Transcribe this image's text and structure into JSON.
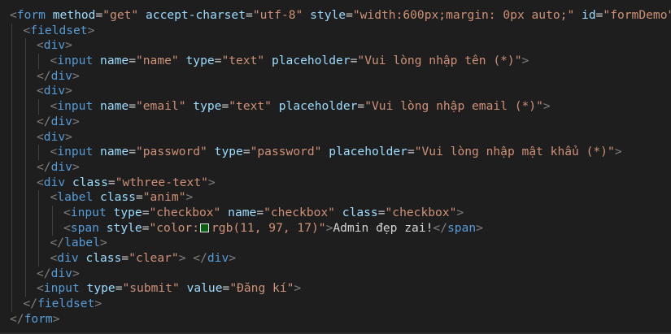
{
  "editor": {
    "language": "html",
    "theme": "dark",
    "lines": [
      {
        "indent": 0,
        "tokens": [
          {
            "t": "punc",
            "v": "<"
          },
          {
            "t": "tag",
            "v": "form"
          },
          {
            "t": "text",
            "v": " "
          },
          {
            "t": "attr",
            "v": "method"
          },
          {
            "t": "text",
            "v": "="
          },
          {
            "t": "str",
            "v": "\"get\""
          },
          {
            "t": "text",
            "v": " "
          },
          {
            "t": "attr",
            "v": "accept-charset"
          },
          {
            "t": "text",
            "v": "="
          },
          {
            "t": "str",
            "v": "\"utf-8\""
          },
          {
            "t": "text",
            "v": " "
          },
          {
            "t": "attr",
            "v": "style"
          },
          {
            "t": "text",
            "v": "="
          },
          {
            "t": "str",
            "v": "\"width:600px;margin: 0px auto;\""
          },
          {
            "t": "text",
            "v": " "
          },
          {
            "t": "attr",
            "v": "id"
          },
          {
            "t": "text",
            "v": "="
          },
          {
            "t": "str",
            "v": "\"formDemo\""
          },
          {
            "t": "punc",
            "v": ">"
          }
        ]
      },
      {
        "indent": 1,
        "tokens": [
          {
            "t": "punc",
            "v": "<"
          },
          {
            "t": "tag",
            "v": "fieldset"
          },
          {
            "t": "punc",
            "v": ">"
          }
        ]
      },
      {
        "indent": 2,
        "tokens": [
          {
            "t": "punc",
            "v": "<"
          },
          {
            "t": "tag",
            "v": "div"
          },
          {
            "t": "punc",
            "v": ">"
          }
        ]
      },
      {
        "indent": 3,
        "tokens": [
          {
            "t": "punc",
            "v": "<"
          },
          {
            "t": "tag",
            "v": "input"
          },
          {
            "t": "text",
            "v": " "
          },
          {
            "t": "attr",
            "v": "name"
          },
          {
            "t": "text",
            "v": "="
          },
          {
            "t": "str",
            "v": "\"name\""
          },
          {
            "t": "text",
            "v": " "
          },
          {
            "t": "attr",
            "v": "type"
          },
          {
            "t": "text",
            "v": "="
          },
          {
            "t": "str",
            "v": "\"text\""
          },
          {
            "t": "text",
            "v": " "
          },
          {
            "t": "attr",
            "v": "placeholder"
          },
          {
            "t": "text",
            "v": "="
          },
          {
            "t": "str",
            "v": "\"Vui lòng nhập tên (*)\""
          },
          {
            "t": "punc",
            "v": ">"
          }
        ]
      },
      {
        "indent": 2,
        "tokens": [
          {
            "t": "punc",
            "v": "</"
          },
          {
            "t": "tag",
            "v": "div"
          },
          {
            "t": "punc",
            "v": ">"
          }
        ]
      },
      {
        "indent": 2,
        "tokens": [
          {
            "t": "punc",
            "v": "<"
          },
          {
            "t": "tag",
            "v": "div"
          },
          {
            "t": "punc",
            "v": ">"
          }
        ]
      },
      {
        "indent": 3,
        "tokens": [
          {
            "t": "punc",
            "v": "<"
          },
          {
            "t": "tag",
            "v": "input"
          },
          {
            "t": "text",
            "v": " "
          },
          {
            "t": "attr",
            "v": "name"
          },
          {
            "t": "text",
            "v": "="
          },
          {
            "t": "str",
            "v": "\"email\""
          },
          {
            "t": "text",
            "v": " "
          },
          {
            "t": "attr",
            "v": "type"
          },
          {
            "t": "text",
            "v": "="
          },
          {
            "t": "str",
            "v": "\"text\""
          },
          {
            "t": "text",
            "v": " "
          },
          {
            "t": "attr",
            "v": "placeholder"
          },
          {
            "t": "text",
            "v": "="
          },
          {
            "t": "str",
            "v": "\"Vui lòng nhập email (*)\""
          },
          {
            "t": "punc",
            "v": ">"
          }
        ]
      },
      {
        "indent": 2,
        "tokens": [
          {
            "t": "punc",
            "v": "</"
          },
          {
            "t": "tag",
            "v": "div"
          },
          {
            "t": "punc",
            "v": ">"
          }
        ]
      },
      {
        "indent": 2,
        "tokens": [
          {
            "t": "punc",
            "v": "<"
          },
          {
            "t": "tag",
            "v": "div"
          },
          {
            "t": "punc",
            "v": ">"
          }
        ]
      },
      {
        "indent": 3,
        "tokens": [
          {
            "t": "punc",
            "v": "<"
          },
          {
            "t": "tag",
            "v": "input"
          },
          {
            "t": "text",
            "v": " "
          },
          {
            "t": "attr",
            "v": "name"
          },
          {
            "t": "text",
            "v": "="
          },
          {
            "t": "str",
            "v": "\"password\""
          },
          {
            "t": "text",
            "v": " "
          },
          {
            "t": "attr",
            "v": "type"
          },
          {
            "t": "text",
            "v": "="
          },
          {
            "t": "str",
            "v": "\"password\""
          },
          {
            "t": "text",
            "v": " "
          },
          {
            "t": "attr",
            "v": "placeholder"
          },
          {
            "t": "text",
            "v": "="
          },
          {
            "t": "str",
            "v": "\"Vui lòng nhập mật khẩu (*)\""
          },
          {
            "t": "punc",
            "v": ">"
          }
        ]
      },
      {
        "indent": 2,
        "tokens": [
          {
            "t": "punc",
            "v": "</"
          },
          {
            "t": "tag",
            "v": "div"
          },
          {
            "t": "punc",
            "v": ">"
          }
        ]
      },
      {
        "indent": 2,
        "tokens": [
          {
            "t": "punc",
            "v": "<"
          },
          {
            "t": "tag",
            "v": "div"
          },
          {
            "t": "text",
            "v": " "
          },
          {
            "t": "attr",
            "v": "class"
          },
          {
            "t": "text",
            "v": "="
          },
          {
            "t": "str",
            "v": "\"wthree-text\""
          },
          {
            "t": "punc",
            "v": ">"
          }
        ]
      },
      {
        "indent": 3,
        "tokens": [
          {
            "t": "punc",
            "v": "<"
          },
          {
            "t": "tag",
            "v": "label"
          },
          {
            "t": "text",
            "v": " "
          },
          {
            "t": "attr",
            "v": "class"
          },
          {
            "t": "text",
            "v": "="
          },
          {
            "t": "str",
            "v": "\"anim\""
          },
          {
            "t": "punc",
            "v": ">"
          }
        ]
      },
      {
        "indent": 4,
        "tokens": [
          {
            "t": "punc",
            "v": "<"
          },
          {
            "t": "tag",
            "v": "input"
          },
          {
            "t": "text",
            "v": " "
          },
          {
            "t": "attr",
            "v": "type"
          },
          {
            "t": "text",
            "v": "="
          },
          {
            "t": "str",
            "v": "\"checkbox\""
          },
          {
            "t": "text",
            "v": " "
          },
          {
            "t": "attr",
            "v": "name"
          },
          {
            "t": "text",
            "v": "="
          },
          {
            "t": "str",
            "v": "\"checkbox\""
          },
          {
            "t": "text",
            "v": " "
          },
          {
            "t": "attr",
            "v": "class"
          },
          {
            "t": "text",
            "v": "="
          },
          {
            "t": "str",
            "v": "\"checkbox\""
          },
          {
            "t": "punc",
            "v": ">"
          }
        ]
      },
      {
        "indent": 4,
        "tokens": [
          {
            "t": "punc",
            "v": "<"
          },
          {
            "t": "tag",
            "v": "span"
          },
          {
            "t": "text",
            "v": " "
          },
          {
            "t": "attr",
            "v": "style"
          },
          {
            "t": "text",
            "v": "="
          },
          {
            "t": "str",
            "v": "\"color:"
          },
          {
            "t": "swatch",
            "v": "#0b6111"
          },
          {
            "t": "str",
            "v": "rgb(11, 97, 17)\""
          },
          {
            "t": "punc",
            "v": ">"
          },
          {
            "t": "text",
            "v": "Admin đẹp zai!"
          },
          {
            "t": "punc",
            "v": "</"
          },
          {
            "t": "tag",
            "v": "span"
          },
          {
            "t": "punc",
            "v": ">"
          }
        ]
      },
      {
        "indent": 3,
        "tokens": [
          {
            "t": "punc",
            "v": "</"
          },
          {
            "t": "tag",
            "v": "label"
          },
          {
            "t": "punc",
            "v": ">"
          }
        ]
      },
      {
        "indent": 3,
        "tokens": [
          {
            "t": "punc",
            "v": "<"
          },
          {
            "t": "tag",
            "v": "div"
          },
          {
            "t": "text",
            "v": " "
          },
          {
            "t": "attr",
            "v": "class"
          },
          {
            "t": "text",
            "v": "="
          },
          {
            "t": "str",
            "v": "\"clear\""
          },
          {
            "t": "punc",
            "v": ">"
          },
          {
            "t": "text",
            "v": " "
          },
          {
            "t": "punc",
            "v": "</"
          },
          {
            "t": "tag",
            "v": "div"
          },
          {
            "t": "punc",
            "v": ">"
          }
        ]
      },
      {
        "indent": 2,
        "tokens": [
          {
            "t": "punc",
            "v": "</"
          },
          {
            "t": "tag",
            "v": "div"
          },
          {
            "t": "punc",
            "v": ">"
          }
        ]
      },
      {
        "indent": 2,
        "tokens": [
          {
            "t": "punc",
            "v": "<"
          },
          {
            "t": "tag",
            "v": "input"
          },
          {
            "t": "text",
            "v": " "
          },
          {
            "t": "attr",
            "v": "type"
          },
          {
            "t": "text",
            "v": "="
          },
          {
            "t": "str",
            "v": "\"submit\""
          },
          {
            "t": "text",
            "v": " "
          },
          {
            "t": "attr",
            "v": "value"
          },
          {
            "t": "text",
            "v": "="
          },
          {
            "t": "str",
            "v": "\"Đăng kí\""
          },
          {
            "t": "punc",
            "v": ">"
          }
        ]
      },
      {
        "indent": 1,
        "tokens": [
          {
            "t": "punc",
            "v": "</"
          },
          {
            "t": "tag",
            "v": "fieldset"
          },
          {
            "t": "punc",
            "v": ">"
          }
        ]
      },
      {
        "indent": 0,
        "tokens": [
          {
            "t": "punc",
            "v": "</"
          },
          {
            "t": "tag",
            "v": "form"
          },
          {
            "t": "punc",
            "v": ">"
          }
        ]
      }
    ]
  }
}
